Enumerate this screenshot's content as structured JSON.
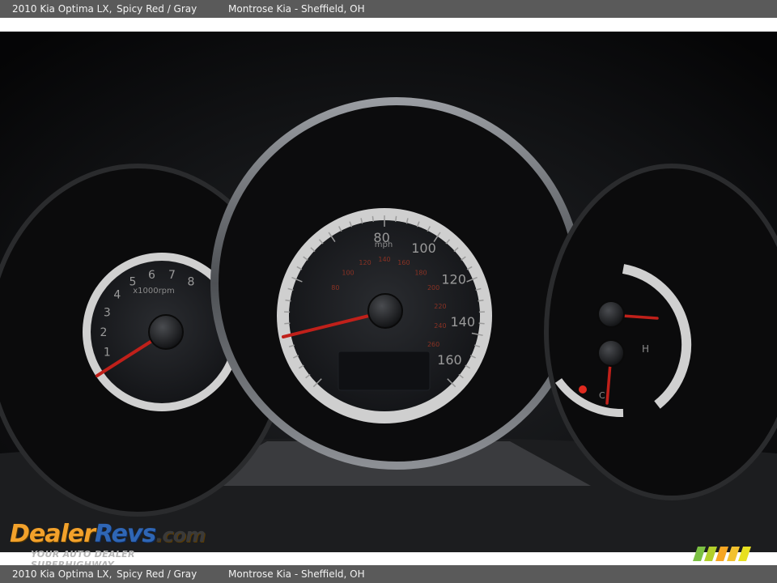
{
  "caption": {
    "vehicle": "2010 Kia Optima LX,",
    "color": "Spicy Red / Gray",
    "dealer": "Montrose Kia - Sheffield, OH"
  },
  "speedometer": {
    "mph_labels": [
      "80",
      "100",
      "120",
      "140",
      "160"
    ],
    "kmh_labels": [
      "80",
      "100",
      "120",
      "140",
      "160",
      "180",
      "200",
      "220",
      "240",
      "260"
    ],
    "unit": "mph",
    "needle_reading_mph": 0
  },
  "tachometer": {
    "labels": [
      "1",
      "2",
      "3",
      "4",
      "5",
      "6",
      "7",
      "8"
    ],
    "unit": "x1000rpm",
    "needle_reading": 0
  },
  "right_gauges": {
    "fuel_marks": [
      "H",
      "C"
    ],
    "needle_color": "#c0201a"
  },
  "logo": {
    "part1": "Dealer",
    "part2": "Revs",
    "part3": ".com",
    "tagline": "YOUR AUTO DEALER SUPERHIGHWAY"
  },
  "colors": {
    "caption_bar": "#5a5a5a",
    "needle": "#c0201a",
    "dial_ring": "#d8d8d8",
    "scale_red": "#8a3224"
  }
}
